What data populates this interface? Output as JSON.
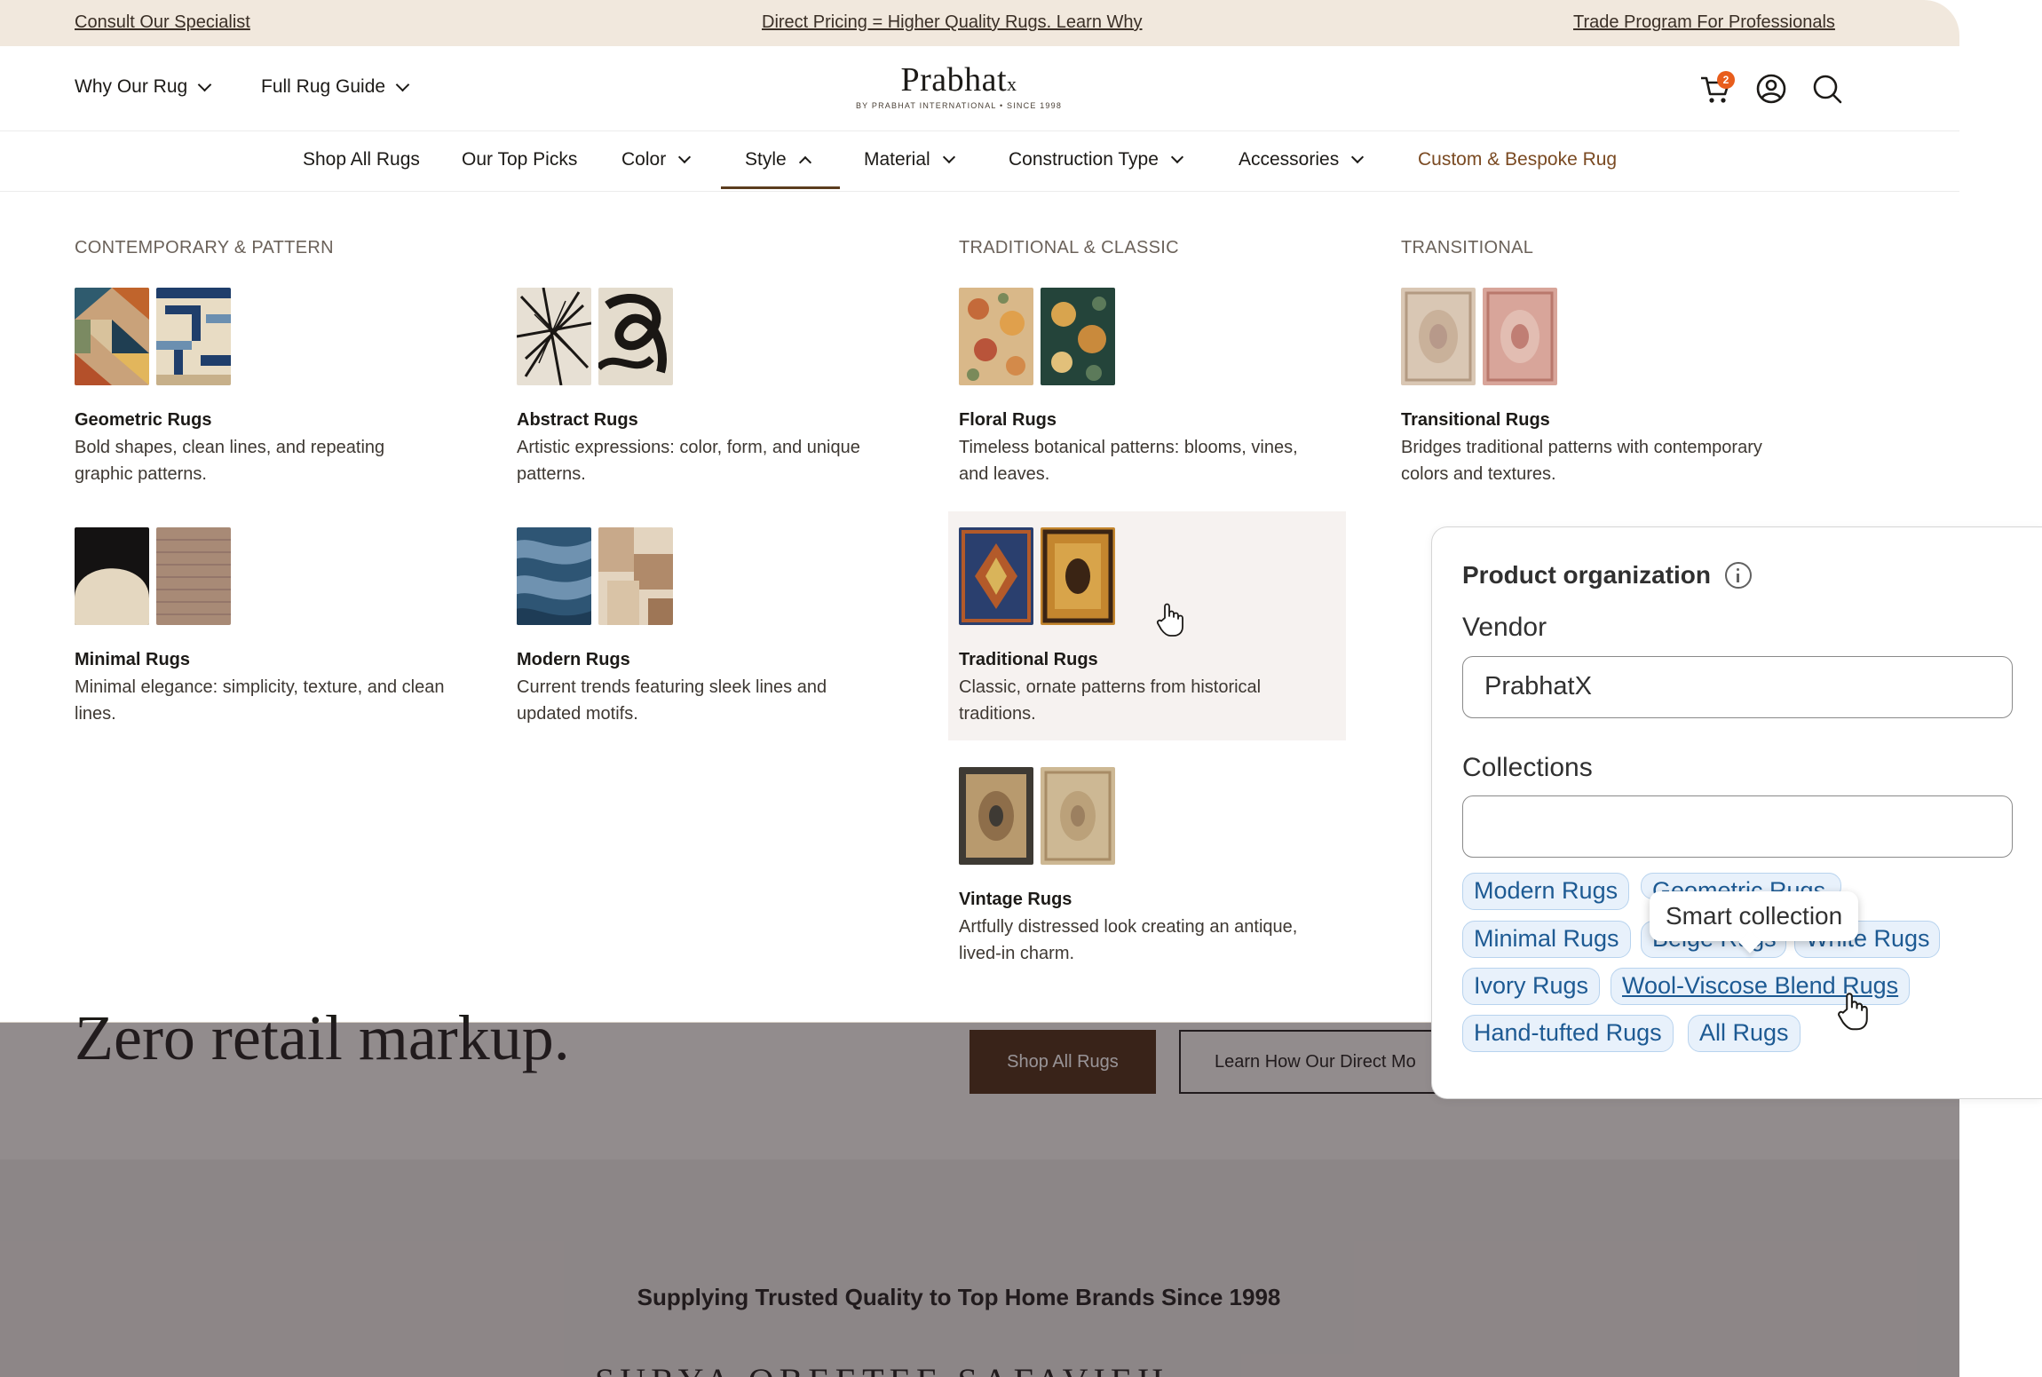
{
  "promo": {
    "left": "Consult Our Specialist",
    "center": "Direct Pricing = Higher Quality Rugs. Learn Why",
    "right": "Trade Program For Professionals"
  },
  "header": {
    "nav_left": [
      "Why Our Rug",
      "Full Rug Guide"
    ],
    "logo_main": "Prabhat",
    "logo_x": "x",
    "logo_sub": "BY PRABHAT INTERNATIONAL • SINCE 1998",
    "cart_count": "2"
  },
  "catnav": {
    "items": [
      "Shop All Rugs",
      "Our Top Picks",
      "Color",
      "Style",
      "Material",
      "Construction Type",
      "Accessories",
      "Custom & Bespoke Rug"
    ]
  },
  "mega": {
    "columns": [
      "CONTEMPORARY & PATTERN",
      "TRADITIONAL & CLASSIC",
      "TRANSITIONAL"
    ],
    "cards": [
      {
        "title": "Geometric Rugs",
        "desc": "Bold shapes, clean lines, and repeating graphic patterns."
      },
      {
        "title": "Abstract Rugs",
        "desc": "Artistic expressions: color, form, and unique patterns."
      },
      {
        "title": "Floral Rugs",
        "desc": "Timeless botanical patterns: blooms, vines, and leaves."
      },
      {
        "title": "Transitional Rugs",
        "desc": "Bridges traditional patterns with contemporary colors and textures."
      },
      {
        "title": "Minimal Rugs",
        "desc": "Minimal elegance: simplicity, texture, and clean lines."
      },
      {
        "title": "Modern Rugs",
        "desc": "Current trends featuring sleek lines and updated motifs."
      },
      {
        "title": "Traditional Rugs",
        "desc": "Classic, ornate patterns from historical traditions."
      },
      {
        "title": "Vintage Rugs",
        "desc": "Artfully distressed look creating an antique, lived-in charm."
      }
    ]
  },
  "hero": {
    "title": "Zero retail markup.",
    "btn_primary": "Shop All Rugs",
    "btn_secondary": "Learn How Our Direct Mo",
    "subtitle": "Supplying Trusted Quality to Top Home Brands Since 1998",
    "brands": "SURYA   OBEETEE   SAFAVIEH"
  },
  "panel": {
    "title": "Product organization",
    "vendor_label": "Vendor",
    "vendor_value": "PrabhatX",
    "collections_label": "Collections",
    "collections_value": "",
    "tags": [
      "Modern Rugs",
      "Geometric Rugs",
      "Minimal Rugs",
      "Beige Rugs",
      "White Rugs",
      "Ivory Rugs",
      "Wool-Viscose Blend Rugs",
      "Hand-tufted Rugs",
      "All Rugs"
    ],
    "tooltip": "Smart collection"
  },
  "colors": {
    "promo_bg": "#f1e8dd",
    "accent_brown": "#4a2a10",
    "custom_link": "#7a4a22",
    "tag_bg": "#e8f1fb",
    "tag_text": "#1d5a93"
  }
}
